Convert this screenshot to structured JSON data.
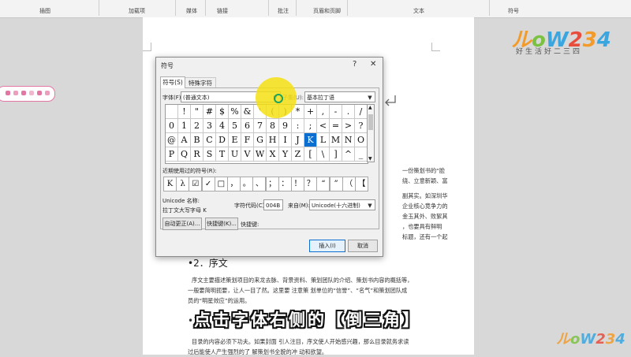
{
  "ribbon": {
    "groups": [
      "插图",
      "加载项",
      "媒体",
      "链接",
      "批注",
      "页眉和页脚",
      "文本",
      "符号"
    ]
  },
  "logo": {
    "text": "ルoW234",
    "slogan": "好生活好二三四",
    "colors": {
      "orange": "#f39b2a",
      "green": "#7cc242",
      "blue": "#3aa6e0",
      "red": "#e84c3d"
    }
  },
  "document": {
    "right_fragments": [
      "一份策划书的“脸",
      "绕、立意新颖、富",
      "副其实。如深圳华",
      "企业核心竞争力的",
      "金玉其外、败絮其",
      "，也要具有鲜明",
      "标题，还有一个起"
    ],
    "heading2": "•2．序文",
    "para1": [
      "序文主要描述策划项目的来龙去脉、背景资料、策划团队的介绍、策划书内容的概括等，",
      "一般要简明扼要，让人一目了然。这里要  注意策  划单位的“信誉”、“名气”和策划团队成",
      "员的“明星效应”的运用。"
    ],
    "heading3_marker": "•3",
    "para2": [
      "目录的内容必须下功夫。如果封面  引人注目，序文使人开始感兴趣，那么目录就务求读",
      "过后能使人产生强烈的了  解策划书全貌的冲  动和欲望。"
    ]
  },
  "dialog": {
    "title": "符号",
    "help": "?",
    "close": "✕",
    "tabs": [
      "符号(S)",
      "特殊字符(P)"
    ],
    "font_label": "字体(F):",
    "font_value": "(普通文本)",
    "subset_label": "子集(U):",
    "subset_value": "基本拉丁语",
    "symbol_rows": [
      [
        " ",
        "!",
        "\"",
        "#",
        "$",
        "%",
        "&",
        "'",
        "(",
        ")",
        "*",
        "+",
        ",",
        "-",
        ".",
        "/"
      ],
      [
        "0",
        "1",
        "2",
        "3",
        "4",
        "5",
        "6",
        "7",
        "8",
        "9",
        ":",
        ";",
        "<",
        "=",
        ">",
        "?"
      ],
      [
        "@",
        "A",
        "B",
        "C",
        "D",
        "E",
        "F",
        "G",
        "H",
        "I",
        "J",
        "K",
        "L",
        "M",
        "N",
        "O"
      ],
      [
        "P",
        "Q",
        "R",
        "S",
        "T",
        "U",
        "V",
        "W",
        "X",
        "Y",
        "Z",
        "[",
        "\\",
        "]",
        "^",
        "_"
      ]
    ],
    "selected_symbol": "K",
    "recent_label": "近期使用过的符号(R):",
    "recent_symbols": [
      "K",
      "λ",
      "☑",
      "✓",
      "□",
      "，",
      "。",
      "、",
      "；",
      "：",
      "！",
      "？",
      "“",
      "”",
      "（",
      "【"
    ],
    "unicode_name_label": "Unicode 名称:",
    "unicode_name_value": "拉丁文大写字母 K",
    "char_code_label": "字符代码(C):",
    "char_code_value": "004B",
    "from_label": "来自(M):",
    "from_value": "Unicode(十六进制)",
    "autocorrect_button": "自动更正(A)...",
    "shortcut_button": "快捷键(K)...",
    "shortcut_label": "快捷键:",
    "insert_button": "插入(I)",
    "cancel_button": "取消"
  },
  "caption": "点击字体右侧的【倒三角】",
  "colors": {
    "selection": "#0a6fd1",
    "highlight": "#f5e114",
    "toolstrip_border": "#e277a4"
  }
}
